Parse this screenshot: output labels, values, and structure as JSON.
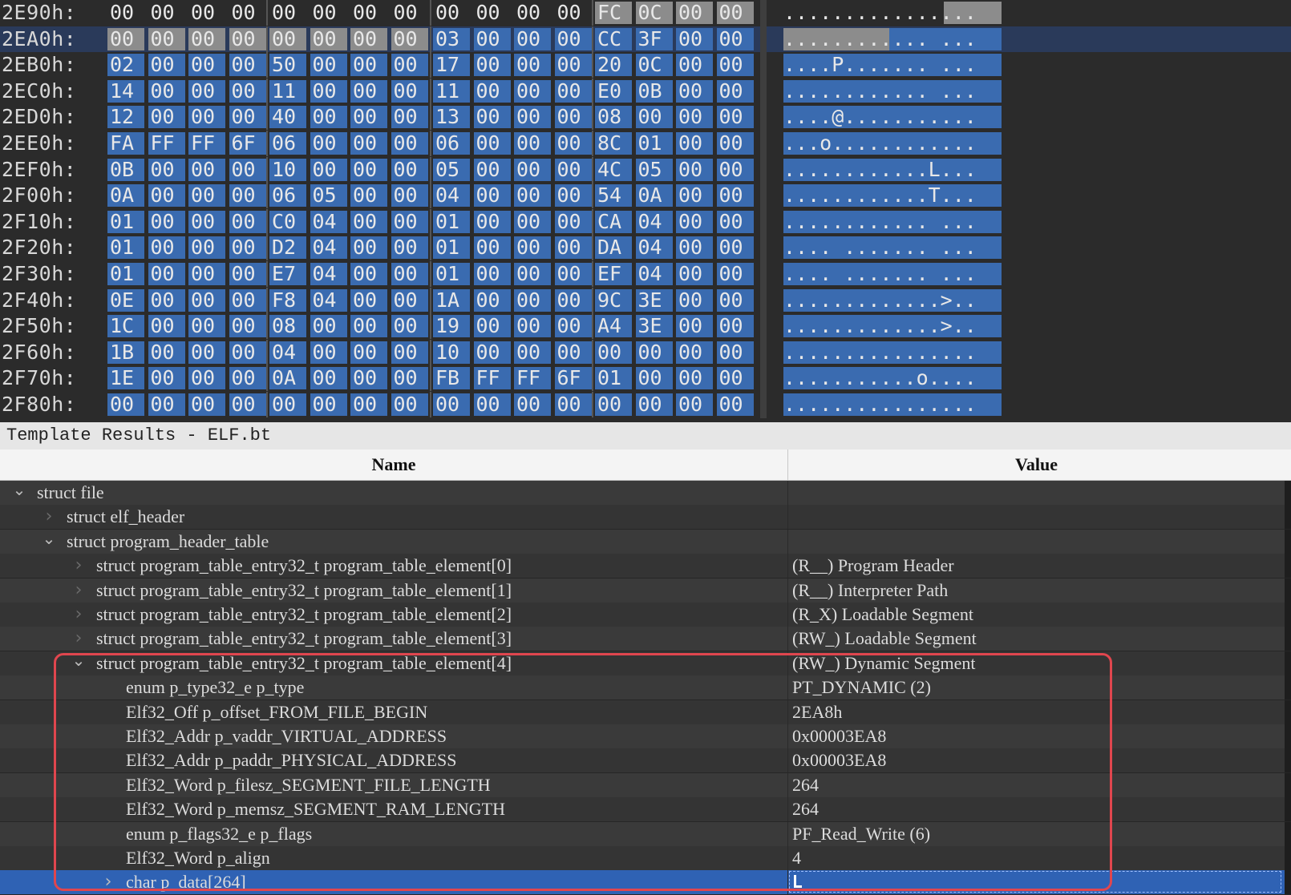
{
  "hex_view": {
    "rows": [
      {
        "addr": "2E90h:",
        "bytes": [
          "00",
          "00",
          "00",
          "00",
          "00",
          "00",
          "00",
          "00",
          "00",
          "00",
          "00",
          "00",
          "FC",
          "0C",
          "00",
          "00"
        ],
        "ascii": "................"
      },
      {
        "addr": "2EA0h:",
        "bytes": [
          "00",
          "00",
          "00",
          "00",
          "00",
          "00",
          "00",
          "00",
          "03",
          "00",
          "00",
          "00",
          "CC",
          "3F",
          "00",
          "00"
        ],
        "ascii": "............ ..."
      },
      {
        "addr": "2EB0h:",
        "bytes": [
          "02",
          "00",
          "00",
          "00",
          "50",
          "00",
          "00",
          "00",
          "17",
          "00",
          "00",
          "00",
          "20",
          "0C",
          "00",
          "00"
        ],
        "ascii": "....P....... ..."
      },
      {
        "addr": "2EC0h:",
        "bytes": [
          "14",
          "00",
          "00",
          "00",
          "11",
          "00",
          "00",
          "00",
          "11",
          "00",
          "00",
          "00",
          "E0",
          "0B",
          "00",
          "00"
        ],
        "ascii": "............ ..."
      },
      {
        "addr": "2ED0h:",
        "bytes": [
          "12",
          "00",
          "00",
          "00",
          "40",
          "00",
          "00",
          "00",
          "13",
          "00",
          "00",
          "00",
          "08",
          "00",
          "00",
          "00"
        ],
        "ascii": "....@..........."
      },
      {
        "addr": "2EE0h:",
        "bytes": [
          "FA",
          "FF",
          "FF",
          "6F",
          "06",
          "00",
          "00",
          "00",
          "06",
          "00",
          "00",
          "00",
          "8C",
          "01",
          "00",
          "00"
        ],
        "ascii": "...o............"
      },
      {
        "addr": "2EF0h:",
        "bytes": [
          "0B",
          "00",
          "00",
          "00",
          "10",
          "00",
          "00",
          "00",
          "05",
          "00",
          "00",
          "00",
          "4C",
          "05",
          "00",
          "00"
        ],
        "ascii": "............L..."
      },
      {
        "addr": "2F00h:",
        "bytes": [
          "0A",
          "00",
          "00",
          "00",
          "06",
          "05",
          "00",
          "00",
          "04",
          "00",
          "00",
          "00",
          "54",
          "0A",
          "00",
          "00"
        ],
        "ascii": "............T..."
      },
      {
        "addr": "2F10h:",
        "bytes": [
          "01",
          "00",
          "00",
          "00",
          "C0",
          "04",
          "00",
          "00",
          "01",
          "00",
          "00",
          "00",
          "CA",
          "04",
          "00",
          "00"
        ],
        "ascii": "............ ..."
      },
      {
        "addr": "2F20h:",
        "bytes": [
          "01",
          "00",
          "00",
          "00",
          "D2",
          "04",
          "00",
          "00",
          "01",
          "00",
          "00",
          "00",
          "DA",
          "04",
          "00",
          "00"
        ],
        "ascii": ".... ....... ..."
      },
      {
        "addr": "2F30h:",
        "bytes": [
          "01",
          "00",
          "00",
          "00",
          "E7",
          "04",
          "00",
          "00",
          "01",
          "00",
          "00",
          "00",
          "EF",
          "04",
          "00",
          "00"
        ],
        "ascii": ".... ....... ..."
      },
      {
        "addr": "2F40h:",
        "bytes": [
          "0E",
          "00",
          "00",
          "00",
          "F8",
          "04",
          "00",
          "00",
          "1A",
          "00",
          "00",
          "00",
          "9C",
          "3E",
          "00",
          "00"
        ],
        "ascii": ".............>.."
      },
      {
        "addr": "2F50h:",
        "bytes": [
          "1C",
          "00",
          "00",
          "00",
          "08",
          "00",
          "00",
          "00",
          "19",
          "00",
          "00",
          "00",
          "A4",
          "3E",
          "00",
          "00"
        ],
        "ascii": ".............>.."
      },
      {
        "addr": "2F60h:",
        "bytes": [
          "1B",
          "00",
          "00",
          "00",
          "04",
          "00",
          "00",
          "00",
          "10",
          "00",
          "00",
          "00",
          "00",
          "00",
          "00",
          "00"
        ],
        "ascii": "................"
      },
      {
        "addr": "2F70h:",
        "bytes": [
          "1E",
          "00",
          "00",
          "00",
          "0A",
          "00",
          "00",
          "00",
          "FB",
          "FF",
          "FF",
          "6F",
          "01",
          "00",
          "00",
          "00"
        ],
        "ascii": "...........o...."
      },
      {
        "addr": "2F80h:",
        "bytes": [
          "00",
          "00",
          "00",
          "00",
          "00",
          "00",
          "00",
          "00",
          "00",
          "00",
          "00",
          "00",
          "00",
          "00",
          "00",
          "00"
        ],
        "ascii": "................"
      }
    ]
  },
  "template_results": {
    "title": "Template Results - ELF.bt",
    "columns": {
      "name": "Name",
      "value": "Value"
    },
    "rows": [
      {
        "name": "struct file",
        "value": "",
        "indent": 0,
        "expander": "expanded"
      },
      {
        "name": "struct elf_header",
        "value": "",
        "indent": 1,
        "expander": "collapsed-dim"
      },
      {
        "name": "struct program_header_table",
        "value": "",
        "indent": 1,
        "expander": "expanded"
      },
      {
        "name": "struct program_table_entry32_t program_table_element[0]",
        "value": "(R__) Program Header",
        "indent": 2,
        "expander": "collapsed-dim"
      },
      {
        "name": "struct program_table_entry32_t program_table_element[1]",
        "value": "(R__) Interpreter Path",
        "indent": 2,
        "expander": "collapsed-dim"
      },
      {
        "name": "struct program_table_entry32_t program_table_element[2]",
        "value": "(R_X) Loadable Segment",
        "indent": 2,
        "expander": "collapsed-dim"
      },
      {
        "name": "struct program_table_entry32_t program_table_element[3]",
        "value": "(RW_) Loadable Segment",
        "indent": 2,
        "expander": "collapsed-dim"
      },
      {
        "name": "struct program_table_entry32_t program_table_element[4]",
        "value": "(RW_) Dynamic Segment",
        "indent": 2,
        "expander": "expanded"
      },
      {
        "name": "enum p_type32_e p_type",
        "value": "PT_DYNAMIC (2)",
        "indent": 3,
        "expander": "none"
      },
      {
        "name": "Elf32_Off p_offset_FROM_FILE_BEGIN",
        "value": "2EA8h",
        "indent": 3,
        "expander": "none"
      },
      {
        "name": "Elf32_Addr p_vaddr_VIRTUAL_ADDRESS",
        "value": "0x00003EA8",
        "indent": 3,
        "expander": "none"
      },
      {
        "name": "Elf32_Addr p_paddr_PHYSICAL_ADDRESS",
        "value": "0x00003EA8",
        "indent": 3,
        "expander": "none"
      },
      {
        "name": "Elf32_Word p_filesz_SEGMENT_FILE_LENGTH",
        "value": "264",
        "indent": 3,
        "expander": "none"
      },
      {
        "name": "Elf32_Word p_memsz_SEGMENT_RAM_LENGTH",
        "value": "264",
        "indent": 3,
        "expander": "none"
      },
      {
        "name": "enum p_flags32_e p_flags",
        "value": "PF_Read_Write (6)",
        "indent": 3,
        "expander": "none"
      },
      {
        "name": "Elf32_Word p_align",
        "value": "4",
        "indent": 3,
        "expander": "none"
      },
      {
        "name": "char p_data[264]",
        "value": "",
        "indent": 3,
        "expander": "collapsed",
        "selected": true
      }
    ]
  },
  "colors": {
    "selection": "#3a6bb0",
    "highlight_box": "#e0464e",
    "selected_row": "#2f62b4"
  }
}
